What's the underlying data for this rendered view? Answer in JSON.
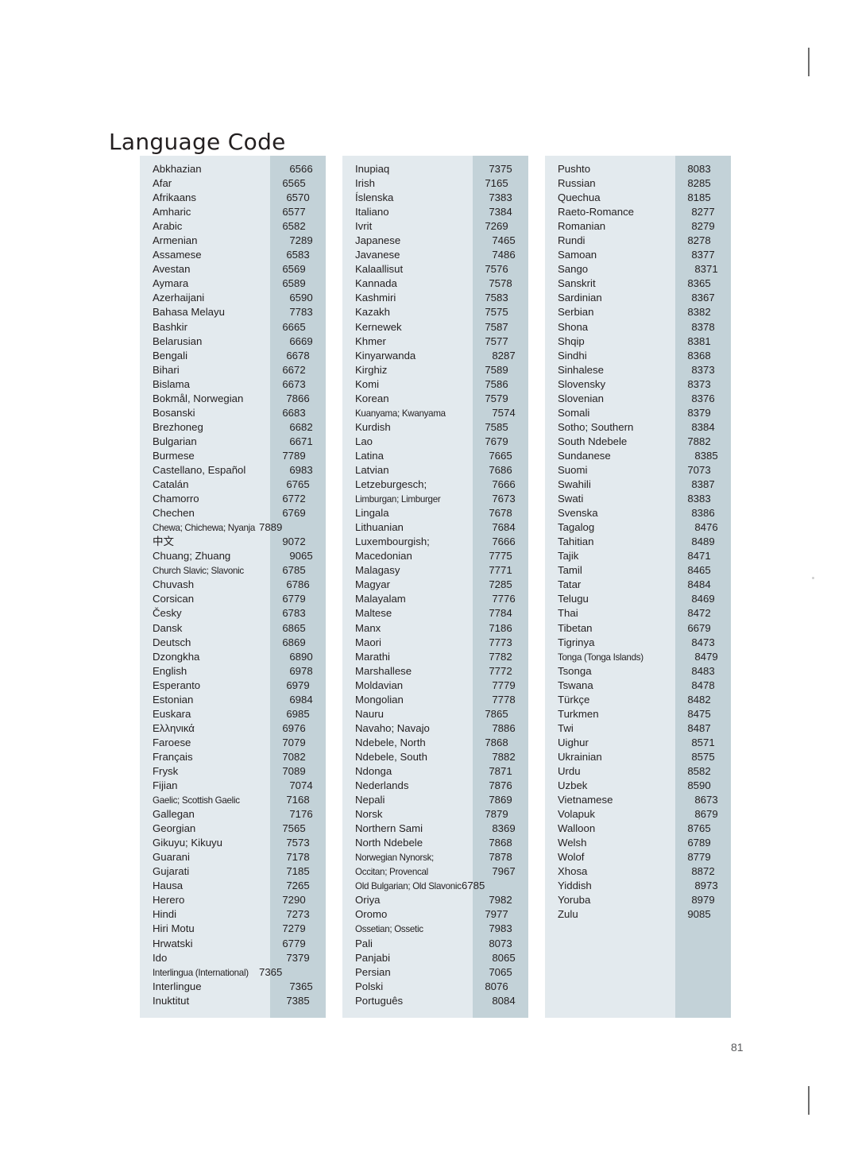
{
  "document": {
    "title": "Language Code",
    "page_number": "81"
  },
  "columns": [
    {
      "id": "column-1",
      "rows": [
        {
          "language": "Abkhazian",
          "code": "6566",
          "align": "r"
        },
        {
          "language": "Afar",
          "code": "6565",
          "align": "l"
        },
        {
          "language": "Afrikaans",
          "code": "6570",
          "align": "c"
        },
        {
          "language": "Amharic",
          "code": "6577",
          "align": "l"
        },
        {
          "language": "Arabic",
          "code": "6582",
          "align": "l"
        },
        {
          "language": "Armenian",
          "code": "7289",
          "align": "r"
        },
        {
          "language": "Assamese",
          "code": "6583",
          "align": "c"
        },
        {
          "language": "Avestan",
          "code": "6569",
          "align": "l"
        },
        {
          "language": "Aymara",
          "code": "6589",
          "align": "l"
        },
        {
          "language": "Azerhaijani",
          "code": "6590",
          "align": "r"
        },
        {
          "language": "Bahasa Melayu",
          "code": "7783",
          "align": "r"
        },
        {
          "language": "Bashkir",
          "code": "6665",
          "align": "l"
        },
        {
          "language": "Belarusian",
          "code": "6669",
          "align": "r"
        },
        {
          "language": "Bengali",
          "code": "6678",
          "align": "c"
        },
        {
          "language": "Bihari",
          "code": "6672",
          "align": "l"
        },
        {
          "language": "Bislama",
          "code": "6673",
          "align": "l"
        },
        {
          "language": "Bokmål, Norwegian",
          "code": "7866",
          "align": "c"
        },
        {
          "language": "Bosanski",
          "code": "6683",
          "align": "l"
        },
        {
          "language": "Brezhoneg",
          "code": "6682",
          "align": "r"
        },
        {
          "language": "Bulgarian",
          "code": "6671",
          "align": "r"
        },
        {
          "language": "Burmese",
          "code": "7789",
          "align": "l"
        },
        {
          "language": "Castellano, Español",
          "code": "6983",
          "align": "r"
        },
        {
          "language": "Catalán",
          "code": "6765",
          "align": "c"
        },
        {
          "language": "Chamorro",
          "code": "6772",
          "align": "l"
        },
        {
          "language": "Chechen",
          "code": "6769",
          "align": "l"
        },
        {
          "language": "Chewa; Chichewa; Nyanja",
          "code": "7889",
          "align": "squeeze",
          "tight": true
        },
        {
          "language": "中文",
          "code": "9072",
          "align": "l",
          "cjk": true
        },
        {
          "language": "Chuang; Zhuang",
          "code": "9065",
          "align": "r"
        },
        {
          "language": "Church Slavic; Slavonic",
          "code": "6785",
          "align": "l",
          "tight": true
        },
        {
          "language": "Chuvash",
          "code": "6786",
          "align": "c"
        },
        {
          "language": "Corsican",
          "code": "6779",
          "align": "l"
        },
        {
          "language": "Česky",
          "code": "6783",
          "align": "l"
        },
        {
          "language": "Dansk",
          "code": "6865",
          "align": "l"
        },
        {
          "language": "Deutsch",
          "code": "6869",
          "align": "l"
        },
        {
          "language": "Dzongkha",
          "code": "6890",
          "align": "r"
        },
        {
          "language": "English",
          "code": "6978",
          "align": "r"
        },
        {
          "language": "Esperanto",
          "code": "6979",
          "align": "c"
        },
        {
          "language": "Estonian",
          "code": "6984",
          "align": "r"
        },
        {
          "language": "Euskara",
          "code": "6985",
          "align": "c"
        },
        {
          "language": "Ελληνικά",
          "code": "6976",
          "align": "l"
        },
        {
          "language": "Faroese",
          "code": "7079",
          "align": "l"
        },
        {
          "language": "Français",
          "code": "7082",
          "align": "l"
        },
        {
          "language": "Frysk",
          "code": "7089",
          "align": "l"
        },
        {
          "language": "Fijian",
          "code": "7074",
          "align": "r"
        },
        {
          "language": "Gaelic; Scottish Gaelic",
          "code": "7168",
          "align": "c",
          "tight": true
        },
        {
          "language": "Gallegan",
          "code": "7176",
          "align": "r"
        },
        {
          "language": "Georgian",
          "code": "7565",
          "align": "l"
        },
        {
          "language": "Gikuyu; Kikuyu",
          "code": "7573",
          "align": "c"
        },
        {
          "language": "Guarani",
          "code": "7178",
          "align": "c"
        },
        {
          "language": "Gujarati",
          "code": "7185",
          "align": "c"
        },
        {
          "language": "Hausa",
          "code": "7265",
          "align": "c"
        },
        {
          "language": "Herero",
          "code": "7290",
          "align": "l"
        },
        {
          "language": "Hindi",
          "code": "7273",
          "align": "c"
        },
        {
          "language": "Hiri Motu",
          "code": "7279",
          "align": "l"
        },
        {
          "language": "Hrwatski",
          "code": "6779",
          "align": "l"
        },
        {
          "language": "Ido",
          "code": "7379",
          "align": "c"
        },
        {
          "language": "Interlingua (International)",
          "code": "7365",
          "align": "squeeze",
          "tight": true
        },
        {
          "language": "Interlingue",
          "code": "7365",
          "align": "r"
        },
        {
          "language": "Inuktitut",
          "code": "7385",
          "align": "c"
        }
      ]
    },
    {
      "id": "column-2",
      "rows": [
        {
          "language": "Inupiaq",
          "code": "7375",
          "align": "c"
        },
        {
          "language": "Irish",
          "code": "7165",
          "align": "l"
        },
        {
          "language": "Íslenska",
          "code": "7383",
          "align": "c"
        },
        {
          "language": "Italiano",
          "code": "7384",
          "align": "c"
        },
        {
          "language": "Ivrit",
          "code": "7269",
          "align": "l"
        },
        {
          "language": "Japanese",
          "code": "7465",
          "align": "r"
        },
        {
          "language": "Javanese",
          "code": "7486",
          "align": "r"
        },
        {
          "language": "Kalaallisut",
          "code": "7576",
          "align": "l"
        },
        {
          "language": "Kannada",
          "code": "7578",
          "align": "c"
        },
        {
          "language": "Kashmiri",
          "code": "7583",
          "align": "l"
        },
        {
          "language": "Kazakh",
          "code": "7575",
          "align": "l"
        },
        {
          "language": "Kernewek",
          "code": "7587",
          "align": "l"
        },
        {
          "language": "Khmer",
          "code": "7577",
          "align": "l"
        },
        {
          "language": "Kinyarwanda",
          "code": "8287",
          "align": "r"
        },
        {
          "language": "Kirghiz",
          "code": "7589",
          "align": "l"
        },
        {
          "language": "Komi",
          "code": "7586",
          "align": "l"
        },
        {
          "language": "Korean",
          "code": "7579",
          "align": "l"
        },
        {
          "language": "Kuanyama; Kwanyama",
          "code": "7574",
          "align": "r",
          "tight": true
        },
        {
          "language": "Kurdish",
          "code": "7585",
          "align": "l"
        },
        {
          "language": "Lao",
          "code": "7679",
          "align": "l"
        },
        {
          "language": "Latina",
          "code": "7665",
          "align": "c"
        },
        {
          "language": "Latvian",
          "code": "7686",
          "align": "c"
        },
        {
          "language": "Letzeburgesch;",
          "code": "7666",
          "align": "r"
        },
        {
          "language": "Limburgan; Limburger",
          "code": "7673",
          "align": "r",
          "tight": true
        },
        {
          "language": "Lingala",
          "code": "7678",
          "align": "c"
        },
        {
          "language": "Lithuanian",
          "code": "7684",
          "align": "r"
        },
        {
          "language": "Luxembourgish;",
          "code": "7666",
          "align": "r"
        },
        {
          "language": "Macedonian",
          "code": "7775",
          "align": "c"
        },
        {
          "language": "Malagasy",
          "code": "7771",
          "align": "c"
        },
        {
          "language": "Magyar",
          "code": "7285",
          "align": "c"
        },
        {
          "language": "Malayalam",
          "code": "7776",
          "align": "r"
        },
        {
          "language": "Maltese",
          "code": "7784",
          "align": "c"
        },
        {
          "language": "Manx",
          "code": "7186",
          "align": "c"
        },
        {
          "language": "Maori",
          "code": "7773",
          "align": "c"
        },
        {
          "language": "Marathi",
          "code": "7782",
          "align": "c"
        },
        {
          "language": "Marshallese",
          "code": "7772",
          "align": "c"
        },
        {
          "language": "Moldavian",
          "code": "7779",
          "align": "r"
        },
        {
          "language": "Mongolian",
          "code": "7778",
          "align": "r"
        },
        {
          "language": "Nauru",
          "code": "7865",
          "align": "l"
        },
        {
          "language": "Navaho; Navajo",
          "code": "7886",
          "align": "r"
        },
        {
          "language": "Ndebele, North",
          "code": "7868",
          "align": "l"
        },
        {
          "language": "Ndebele, South",
          "code": "7882",
          "align": "r"
        },
        {
          "language": "Ndonga",
          "code": "7871",
          "align": "c"
        },
        {
          "language": "Nederlands",
          "code": "7876",
          "align": "c"
        },
        {
          "language": "Nepali",
          "code": "7869",
          "align": "c"
        },
        {
          "language": "Norsk",
          "code": "7879",
          "align": "l"
        },
        {
          "language": "Northern Sami",
          "code": "8369",
          "align": "r"
        },
        {
          "language": "North Ndebele",
          "code": "7868",
          "align": "c"
        },
        {
          "language": "Norwegian Nynorsk;",
          "code": "7878",
          "align": "c",
          "tight": true
        },
        {
          "language": "Occitan; Provencal",
          "code": "7967",
          "align": "r",
          "tight": true
        },
        {
          "language": "Old Bulgarian; Old Slavonic",
          "code": "6785",
          "align": "squeeze",
          "tight": true
        },
        {
          "language": "Oriya",
          "code": "7982",
          "align": "c"
        },
        {
          "language": "Oromo",
          "code": "7977",
          "align": "l"
        },
        {
          "language": "Ossetian; Ossetic",
          "code": "7983",
          "align": "c",
          "tight": true
        },
        {
          "language": "Pali",
          "code": "8073",
          "align": "c"
        },
        {
          "language": "Panjabi",
          "code": "8065",
          "align": "r"
        },
        {
          "language": "Persian",
          "code": "7065",
          "align": "c"
        },
        {
          "language": "Polski",
          "code": "8076",
          "align": "l"
        },
        {
          "language": "Português",
          "code": "8084",
          "align": "r"
        }
      ]
    },
    {
      "id": "column-3",
      "rows": [
        {
          "language": "Pushto",
          "code": "8083",
          "align": "l"
        },
        {
          "language": "Russian",
          "code": "8285",
          "align": "l"
        },
        {
          "language": "Quechua",
          "code": "8185",
          "align": "l"
        },
        {
          "language": "Raeto-Romance",
          "code": "8277",
          "align": "c"
        },
        {
          "language": "Romanian",
          "code": "8279",
          "align": "c"
        },
        {
          "language": "Rundi",
          "code": "8278",
          "align": "l"
        },
        {
          "language": "Samoan",
          "code": "8377",
          "align": "c"
        },
        {
          "language": "Sango",
          "code": "8371",
          "align": "r"
        },
        {
          "language": "Sanskrit",
          "code": "8365",
          "align": "l"
        },
        {
          "language": "Sardinian",
          "code": "8367",
          "align": "c"
        },
        {
          "language": "Serbian",
          "code": "8382",
          "align": "l"
        },
        {
          "language": "Shona",
          "code": "8378",
          "align": "c"
        },
        {
          "language": "Shqip",
          "code": "8381",
          "align": "l"
        },
        {
          "language": "Sindhi",
          "code": "8368",
          "align": "l"
        },
        {
          "language": "Sinhalese",
          "code": "8373",
          "align": "c"
        },
        {
          "language": "Slovensky",
          "code": "8373",
          "align": "l"
        },
        {
          "language": "Slovenian",
          "code": "8376",
          "align": "c"
        },
        {
          "language": "Somali",
          "code": "8379",
          "align": "l"
        },
        {
          "language": "Sotho; Southern",
          "code": "8384",
          "align": "c"
        },
        {
          "language": "South Ndebele",
          "code": "7882",
          "align": "l"
        },
        {
          "language": "Sundanese",
          "code": "8385",
          "align": "r"
        },
        {
          "language": "Suomi",
          "code": "7073",
          "align": "l"
        },
        {
          "language": "Swahili",
          "code": "8387",
          "align": "c"
        },
        {
          "language": "Swati",
          "code": "8383",
          "align": "l"
        },
        {
          "language": "Svenska",
          "code": "8386",
          "align": "c"
        },
        {
          "language": "Tagalog",
          "code": "8476",
          "align": "r"
        },
        {
          "language": "Tahitian",
          "code": "8489",
          "align": "c"
        },
        {
          "language": "Tajik",
          "code": "8471",
          "align": "l"
        },
        {
          "language": "Tamil",
          "code": "8465",
          "align": "l"
        },
        {
          "language": "Tatar",
          "code": "8484",
          "align": "l"
        },
        {
          "language": "Telugu",
          "code": "8469",
          "align": "c"
        },
        {
          "language": "Thai",
          "code": "8472",
          "align": "l"
        },
        {
          "language": "Tibetan",
          "code": "6679",
          "align": "l"
        },
        {
          "language": "Tigrinya",
          "code": "8473",
          "align": "c"
        },
        {
          "language": "Tonga (Tonga Islands)",
          "code": "8479",
          "align": "r",
          "tight": true
        },
        {
          "language": "Tsonga",
          "code": "8483",
          "align": "c"
        },
        {
          "language": "Tswana",
          "code": "8478",
          "align": "c"
        },
        {
          "language": "Türkçe",
          "code": "8482",
          "align": "l"
        },
        {
          "language": "Turkmen",
          "code": "8475",
          "align": "l"
        },
        {
          "language": "Twi",
          "code": "8487",
          "align": "l"
        },
        {
          "language": "Uighur",
          "code": "8571",
          "align": "c"
        },
        {
          "language": "Ukrainian",
          "code": "8575",
          "align": "c"
        },
        {
          "language": "Urdu",
          "code": "8582",
          "align": "l"
        },
        {
          "language": "Uzbek",
          "code": "8590",
          "align": "l"
        },
        {
          "language": "Vietnamese",
          "code": "8673",
          "align": "r"
        },
        {
          "language": "Volapuk",
          "code": "8679",
          "align": "r"
        },
        {
          "language": "Walloon",
          "code": "8765",
          "align": "l"
        },
        {
          "language": "Welsh",
          "code": "6789",
          "align": "l"
        },
        {
          "language": "Wolof",
          "code": "8779",
          "align": "l"
        },
        {
          "language": "Xhosa",
          "code": "8872",
          "align": "c"
        },
        {
          "language": "Yiddish",
          "code": "8973",
          "align": "r"
        },
        {
          "language": "Yoruba",
          "code": "8979",
          "align": "c"
        },
        {
          "language": "Zulu",
          "code": "9085",
          "align": "l"
        }
      ]
    }
  ],
  "colors": {
    "panel_background": "#e3eaee",
    "code_band": "#c3d2d8",
    "text": "#231f20",
    "page_number": "#58595b"
  }
}
